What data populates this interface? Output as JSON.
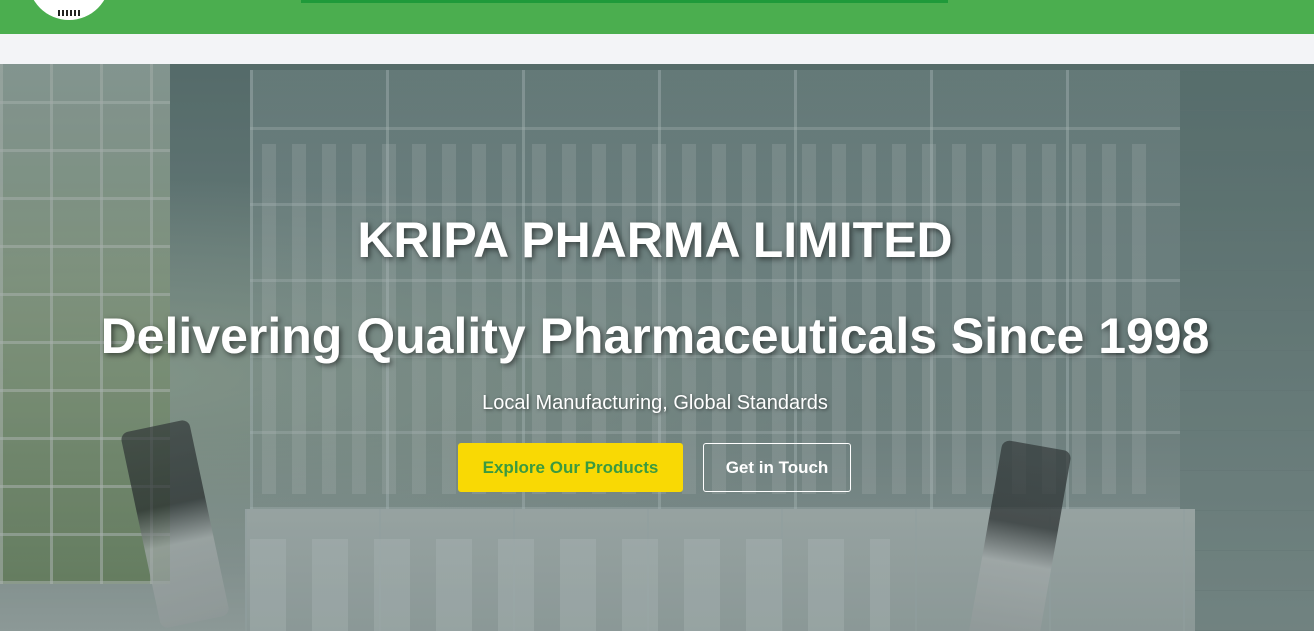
{
  "header": {
    "logo_icon": "company-logo-icon",
    "accent_color": "#4bae4f"
  },
  "hero": {
    "title": "KRIPA PHARMA LIMITED",
    "subtitle": "Delivering Quality Pharmaceuticals Since 1998",
    "tagline": "Local Manufacturing, Global Standards",
    "buttons": {
      "primary_label": "Explore Our Products",
      "secondary_label": "Get in Touch"
    },
    "colors": {
      "primary_button_bg": "#f9d904",
      "primary_button_text": "#3b9a3f",
      "secondary_button_border": "#ffffff"
    },
    "background_image": "laboratory-shelves-image"
  }
}
